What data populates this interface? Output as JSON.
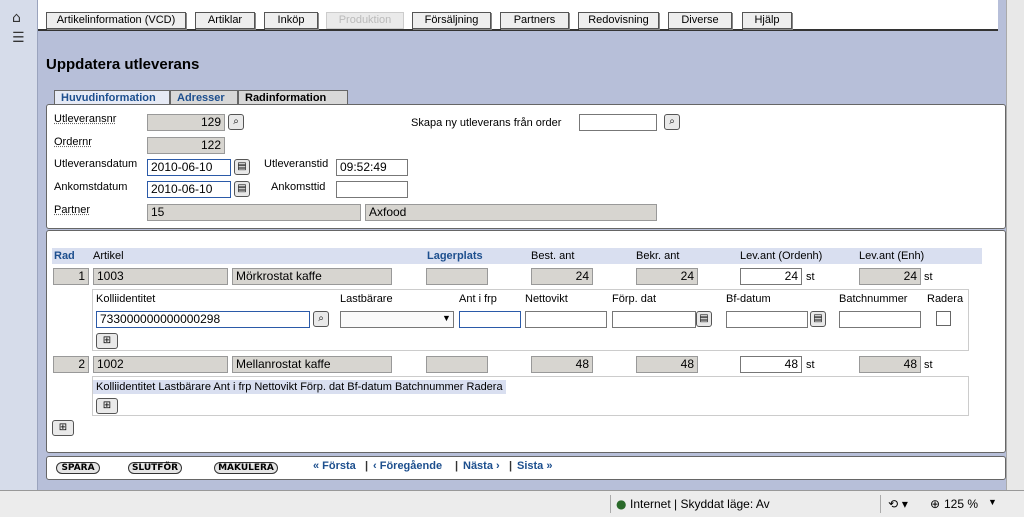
{
  "left_icons": [
    "home-icon",
    "menu-icon"
  ],
  "nav": [
    {
      "label": "Artikelinformation (VCD)",
      "enabled": true
    },
    {
      "label": "Artiklar",
      "enabled": true
    },
    {
      "label": "Inköp",
      "enabled": true
    },
    {
      "label": "Produktion",
      "enabled": false
    },
    {
      "label": "Försäljning",
      "enabled": true
    },
    {
      "label": "Partners",
      "enabled": true
    },
    {
      "label": "Redovisning",
      "enabled": true
    },
    {
      "label": "Diverse",
      "enabled": true
    },
    {
      "label": "Hjälp",
      "enabled": true
    }
  ],
  "page_title": "Uppdatera utleverans",
  "subtabs": [
    "Huvudinformation",
    "Adresser",
    "Radinformation"
  ],
  "form": {
    "utleveransnr_label": "Utleveransnr",
    "utleveransnr": "129",
    "ordernr_label": "Ordernr",
    "ordernr": "122",
    "utleveransdatum_label": "Utleveransdatum",
    "utleveransdatum": "2010-06-10",
    "utleveranstid_label": "Utleveranstid",
    "utleveranstid": "09:52:49",
    "ankomstdatum_label": "Ankomstdatum",
    "ankomstdatum": "2010-06-10",
    "ankomsttid_label": "Ankomsttid",
    "ankomsttid": "",
    "partner_label": "Partner",
    "partner_id": "15",
    "partner_name": "Axfood",
    "skapa_label": "Skapa ny utleverans från order",
    "skapa_value": ""
  },
  "rows_header": {
    "rad": "Rad",
    "artikel": "Artikel",
    "lagerplats": "Lagerplats",
    "best": "Best. ant",
    "bekr": "Bekr. ant",
    "lev_ordenh": "Lev.ant (Ordenh)",
    "lev_enh": "Lev.ant (Enh)"
  },
  "rows": [
    {
      "rad": "1",
      "artikel_nr": "1003",
      "artikel_namn": "Mörkrostat kaffe",
      "lagerplats": "",
      "best": "24",
      "bekr": "24",
      "lev_ordenh": "24",
      "unit1": "st",
      "lev_enh": "24",
      "unit2": "st"
    },
    {
      "rad": "2",
      "artikel_nr": "1002",
      "artikel_namn": "Mellanrostat kaffe",
      "lagerplats": "",
      "best": "48",
      "bekr": "48",
      "lev_ordenh": "48",
      "unit1": "st",
      "lev_enh": "48",
      "unit2": "st"
    }
  ],
  "kolli_header": {
    "kolliidentitet": "Kolliidentitet",
    "lastbarare": "Lastbärare",
    "ant_frp": "Ant i frp",
    "nettovikt": "Nettovikt",
    "forp_dat": "Förp. dat",
    "bf_datum": "Bf-datum",
    "batchnummer": "Batchnummer",
    "radera": "Radera"
  },
  "kolli_row": {
    "kolliidentitet": "733000000000000298",
    "lastbarare": "",
    "ant_frp": "",
    "nettovikt": "",
    "forp_dat": "",
    "bf_datum": "",
    "batchnummer": ""
  },
  "kolli_header_compact": "Kolliidentitet Lastbärare Ant i frp Nettovikt Förp. dat Bf-datum Batchnummer Radera",
  "footer": {
    "spara": "SPARA",
    "slutfor": "SLUTFÖR",
    "makulera": "MAKULERA",
    "forsta": "« Första",
    "foregaende": "‹ Föregående",
    "nasta": "Nästa ›",
    "sista": "Sista »",
    "divider": "|"
  },
  "status": {
    "zone": "Internet | Skyddat läge: Av",
    "zoom": "125 %"
  },
  "colors": {
    "accent": "#1d4f8e",
    "background": "#b7bfd9",
    "readonly": "#d7d5d0"
  }
}
